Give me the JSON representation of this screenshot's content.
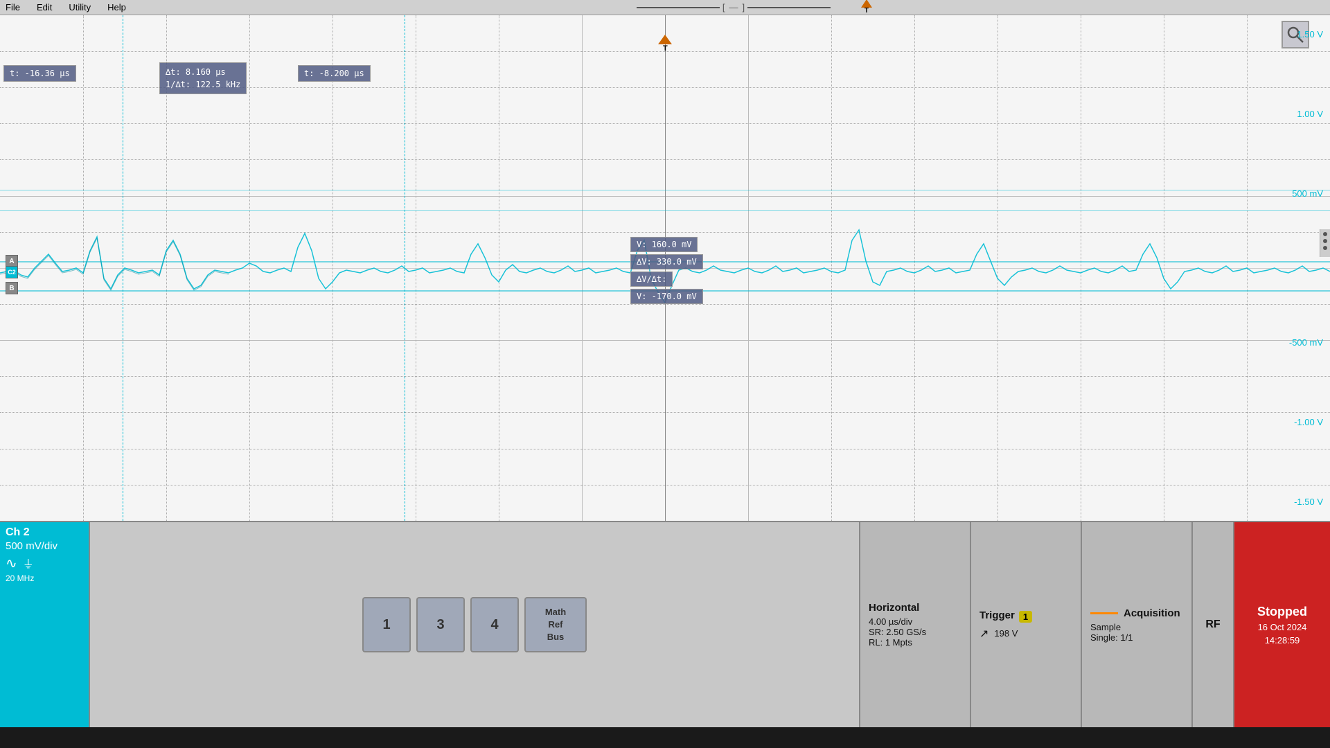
{
  "menubar": {
    "items": [
      "File",
      "Edit",
      "Utility",
      "Help"
    ]
  },
  "scope": {
    "cursor1": {
      "time": "t:  -16.36 µs"
    },
    "cursor_delta": {
      "dt": "∆t:    8.160 µs",
      "freq": "1/∆t: 122.5 kHz"
    },
    "cursor2": {
      "time": "t:  -8.200 µs"
    },
    "voltage_labels": [
      "1.50 V",
      "1.00 V",
      "500 mV",
      "",
      "-500 mV",
      "-1.00 V",
      "-1.50 V"
    ],
    "voltage_values_right": [
      "1.50 V",
      "1.00 V",
      "500 mV",
      "",
      "-500 mV",
      "-1.00 V",
      "-1.50 V"
    ],
    "cursor_v1": {
      "label": "V:    160.0 mV"
    },
    "cursor_dv": {
      "label": "∆V:     330.0 mV"
    },
    "cursor_dvdt": {
      "label": "∆V/∆t:"
    },
    "cursor_v2": {
      "label": "V:   -170.0 mV"
    }
  },
  "channel_labels": {
    "A": "A",
    "C2": "C2",
    "B": "B"
  },
  "status_bar": {
    "channel": {
      "title": "Ch 2",
      "scale": "500 mV/div",
      "bandwidth": "20 MHz",
      "coupling_ac": "∿",
      "coupling_gnd": "⏚"
    },
    "buttons": {
      "btn1": "1",
      "btn3": "3",
      "btn4": "4",
      "math_ref_bus": "Math\nRef\nBus"
    },
    "horizontal": {
      "title": "Horizontal",
      "time_div": "4.00 µs/div",
      "sample_rate": "SR: 2.50 GS/s",
      "record_length": "RL: 1 Mpts"
    },
    "trigger": {
      "title": "Trigger",
      "number": "1",
      "arrow": "↗",
      "level": "198 V"
    },
    "acquisition": {
      "title": "Acquisition",
      "mode": "Sample",
      "ratio": "Single: 1/1"
    },
    "rf_label": "RF",
    "stopped": {
      "label": "Stopped",
      "date": "16 Oct 2024",
      "time": "14:28:59"
    }
  }
}
